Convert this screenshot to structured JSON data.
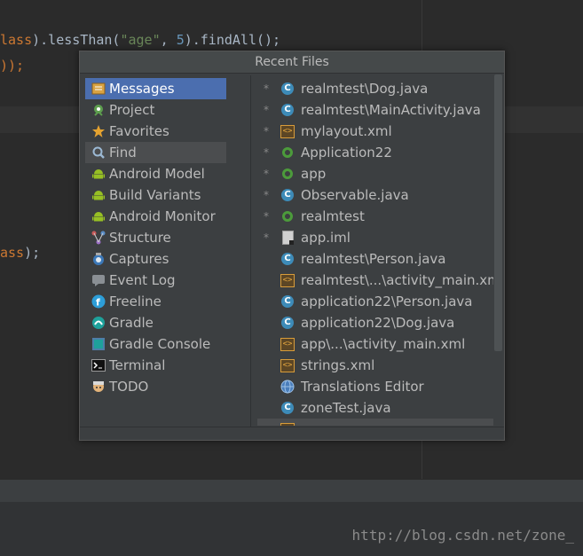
{
  "editor": {
    "code_lines": [
      {
        "tokens": [
          {
            "t": "lass",
            "c": "kw"
          },
          {
            "t": ").lessThan(",
            "c": "fn"
          },
          {
            "t": "\"age\"",
            "c": "str"
          },
          {
            "t": ", ",
            "c": "fn"
          },
          {
            "t": "5",
            "c": "num"
          },
          {
            "t": ").findAll();",
            "c": "fn"
          }
        ]
      },
      {
        "tokens": [
          {
            "t": "));",
            "c": "kw"
          }
        ]
      },
      {
        "tokens": [
          {
            "t": "ass",
            "c": "kw"
          },
          {
            "t": ");",
            "c": "fn"
          }
        ]
      }
    ]
  },
  "popup": {
    "title": "Recent Files",
    "tool_windows": [
      {
        "label": "Messages",
        "icon": "messages-icon",
        "state": "selected"
      },
      {
        "label": "Project",
        "icon": "project-icon",
        "state": ""
      },
      {
        "label": "Favorites",
        "icon": "star-icon",
        "state": ""
      },
      {
        "label": "Find",
        "icon": "find-icon",
        "state": "hovered"
      },
      {
        "label": "Android Model",
        "icon": "android-icon",
        "state": ""
      },
      {
        "label": "Build Variants",
        "icon": "android-icon",
        "state": ""
      },
      {
        "label": "Android Monitor",
        "icon": "android-icon",
        "state": ""
      },
      {
        "label": "Structure",
        "icon": "structure-icon",
        "state": ""
      },
      {
        "label": "Captures",
        "icon": "captures-icon",
        "state": ""
      },
      {
        "label": "Event Log",
        "icon": "event-log-icon",
        "state": ""
      },
      {
        "label": "Freeline",
        "icon": "freeline-icon",
        "state": ""
      },
      {
        "label": "Gradle",
        "icon": "gradle-icon",
        "state": ""
      },
      {
        "label": "Gradle Console",
        "icon": "gradle-console-icon",
        "state": ""
      },
      {
        "label": "Terminal",
        "icon": "terminal-icon",
        "state": ""
      },
      {
        "label": "TODO",
        "icon": "todo-icon",
        "state": ""
      }
    ],
    "recent_files": [
      {
        "label": "realmtest\\Dog.java",
        "icon": "java-class-icon",
        "starred": true
      },
      {
        "label": "realmtest\\MainActivity.java",
        "icon": "java-class-icon",
        "starred": true
      },
      {
        "label": "mylayout.xml",
        "icon": "xml-icon",
        "starred": true
      },
      {
        "label": "Application22",
        "icon": "module-icon",
        "starred": true
      },
      {
        "label": "app",
        "icon": "module-icon",
        "starred": true
      },
      {
        "label": "Observable.java",
        "icon": "java-class-icon",
        "starred": true
      },
      {
        "label": "realmtest",
        "icon": "module-icon",
        "starred": true
      },
      {
        "label": "app.iml",
        "icon": "iml-file-icon",
        "starred": true
      },
      {
        "label": "realmtest\\Person.java",
        "icon": "java-class-icon",
        "starred": false
      },
      {
        "label": "realmtest\\...\\activity_main.xml",
        "icon": "xml-icon",
        "starred": false
      },
      {
        "label": "application22\\Person.java",
        "icon": "java-class-icon",
        "starred": false
      },
      {
        "label": "application22\\Dog.java",
        "icon": "java-class-icon",
        "starred": false
      },
      {
        "label": "app\\...\\activity_main.xml",
        "icon": "xml-icon",
        "starred": false
      },
      {
        "label": "strings.xml",
        "icon": "xml-icon",
        "starred": false
      },
      {
        "label": "Translations Editor",
        "icon": "globe-icon",
        "starred": false
      },
      {
        "label": "zoneTest.java",
        "icon": "java-class-icon",
        "starred": false
      },
      {
        "label": "",
        "icon": "xml-icon",
        "starred": false
      }
    ]
  },
  "watermark": "http://blog.csdn.net/zone_",
  "colors": {
    "selection": "#4b6eaf",
    "background": "#2b2b2b",
    "popup": "#3c3f41"
  }
}
